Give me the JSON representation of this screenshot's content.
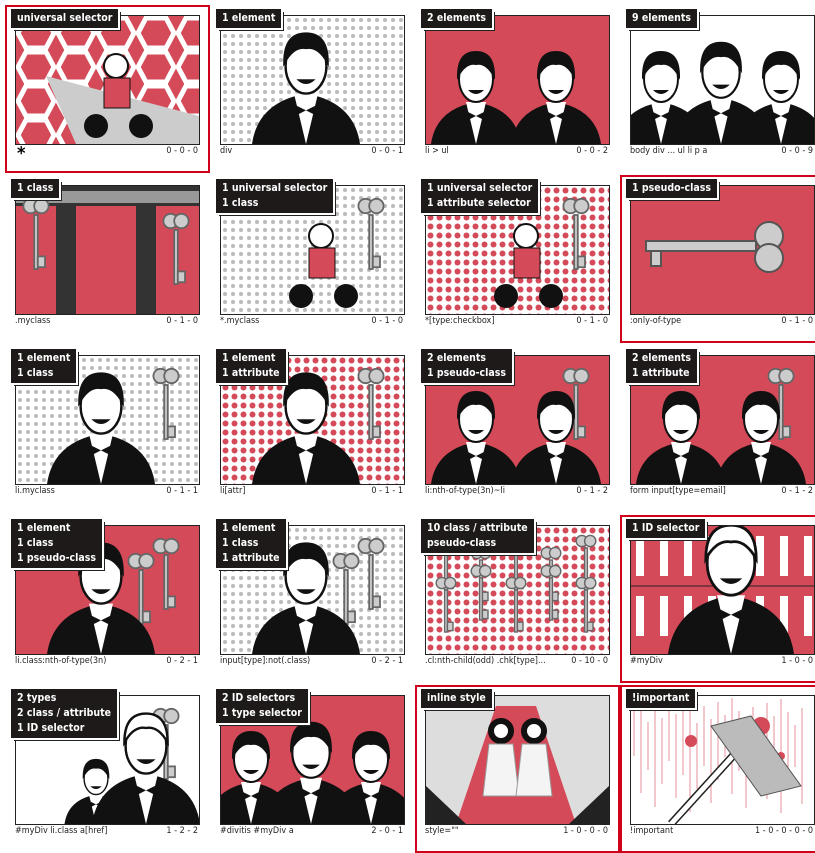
{
  "colors": {
    "accent": "#d0021b",
    "panel_red": "#d54a58",
    "ink": "#1e1a1a",
    "gray": "#bdbdbd"
  },
  "cells": [
    {
      "label": [
        "universal selector"
      ],
      "selector": "",
      "symbol": "*",
      "specificity": "0 - 0 - 0",
      "highlight": true,
      "theme": "hex",
      "men": 0,
      "keys": 0,
      "child": true
    },
    {
      "label": [
        "1 element"
      ],
      "selector": "div",
      "specificity": "0 - 0 - 1",
      "highlight": false,
      "theme": "halftone",
      "men": 1,
      "keys": 0
    },
    {
      "label": [
        "2 elements"
      ],
      "selector": "li > ul",
      "specificity": "0 - 0 - 2",
      "highlight": false,
      "theme": "red",
      "men": 2,
      "keys": 0
    },
    {
      "label": [
        "9 elements"
      ],
      "selector": "body div ... ul li p a",
      "specificity": "0 - 0 - 9",
      "highlight": false,
      "theme": "white",
      "men": 3,
      "keys": 0
    },
    {
      "label": [
        "1 class"
      ],
      "selector": ".myclass",
      "specificity": "0 - 1 - 0",
      "highlight": false,
      "theme": "doors",
      "men": 0,
      "keys": 2
    },
    {
      "label": [
        "1 universal selector",
        "1 class"
      ],
      "selector": "*.myclass",
      "specificity": "0 - 1 - 0",
      "highlight": false,
      "theme": "halftone",
      "men": 0,
      "keys": 1,
      "child": true
    },
    {
      "label": [
        "1 universal selector",
        "1 attribute selector"
      ],
      "selector": "*[type:checkbox]",
      "specificity": "0 - 1 - 0",
      "highlight": false,
      "theme": "redhalftone",
      "men": 0,
      "keys": 1,
      "child": true
    },
    {
      "label": [
        "1 pseudo-class"
      ],
      "selector": ":only-of-type",
      "specificity": "0 - 1 - 0",
      "highlight": true,
      "theme": "red",
      "men": 0,
      "keys": 0,
      "hkey": true
    },
    {
      "label": [
        "1 element",
        "1 class"
      ],
      "selector": "li.myclass",
      "specificity": "0 - 1 - 1",
      "highlight": false,
      "theme": "halftone",
      "men": 1,
      "keys": 1
    },
    {
      "label": [
        "1 element",
        "1 attribute"
      ],
      "selector": "li[attr]",
      "specificity": "0 - 1 - 1",
      "highlight": false,
      "theme": "redhalftone",
      "men": 1,
      "keys": 1
    },
    {
      "label": [
        "2 elements",
        "1 pseudo-class"
      ],
      "selector": "li:nth-of-type(3n)~li",
      "specificity": "0 - 1 - 2",
      "highlight": false,
      "theme": "red",
      "men": 2,
      "keys": 1
    },
    {
      "label": [
        "2 elements",
        "1 attribute"
      ],
      "selector": "form input[type=email]",
      "specificity": "0 - 1 - 2",
      "highlight": false,
      "theme": "red",
      "men": 2,
      "keys": 1
    },
    {
      "label": [
        "1 element",
        "1 class",
        "1 pseudo-class"
      ],
      "selector": "li.class:nth-of-type(3n)",
      "specificity": "0 - 2 - 1",
      "highlight": false,
      "theme": "red",
      "men": 1,
      "keys": 2
    },
    {
      "label": [
        "1 element",
        "1 class",
        "1 attribute"
      ],
      "selector": "input[type]:not(.class)",
      "specificity": "0 - 2 - 1",
      "highlight": false,
      "theme": "halftone",
      "men": 1,
      "keys": 2
    },
    {
      "label": [
        "10 class / attribute",
        "pseudo-class"
      ],
      "selector": ".cl:nth-child(odd) .chk[type]...",
      "specificity": "0 - 10 - 0",
      "highlight": false,
      "theme": "redhalftone",
      "men": 0,
      "keys": 10
    },
    {
      "label": [
        "1 ID selector"
      ],
      "selector": "#myDiv",
      "specificity": "1 - 0 - 0",
      "highlight": true,
      "theme": "bottles",
      "men": 1,
      "keys": 0,
      "old": true
    },
    {
      "label": [
        "2 types",
        "2 class / attribute",
        "1 ID selector"
      ],
      "selector": "#myDiv li.class a[href]",
      "specificity": "1 - 2 - 2",
      "highlight": false,
      "theme": "white",
      "men": 2,
      "keys": 2,
      "old": true
    },
    {
      "label": [
        "2 ID selectors",
        "1 type selector"
      ],
      "selector": "#divitis #myDiv a",
      "specificity": "2 - 0 - 1",
      "highlight": false,
      "theme": "red",
      "men": 3,
      "keys": 0
    },
    {
      "label": [
        "inline style"
      ],
      "selector": "style=\"\"",
      "specificity": "1 - 0 - 0 - 0",
      "highlight": true,
      "theme": "hall",
      "men": 0,
      "keys": 0,
      "twins": true
    },
    {
      "label": [
        "!important"
      ],
      "selector": "!important",
      "specificity": "1 - 0 - 0 - 0 - 0",
      "highlight": true,
      "theme": "blood",
      "men": 0,
      "keys": 0,
      "axe": true
    }
  ]
}
